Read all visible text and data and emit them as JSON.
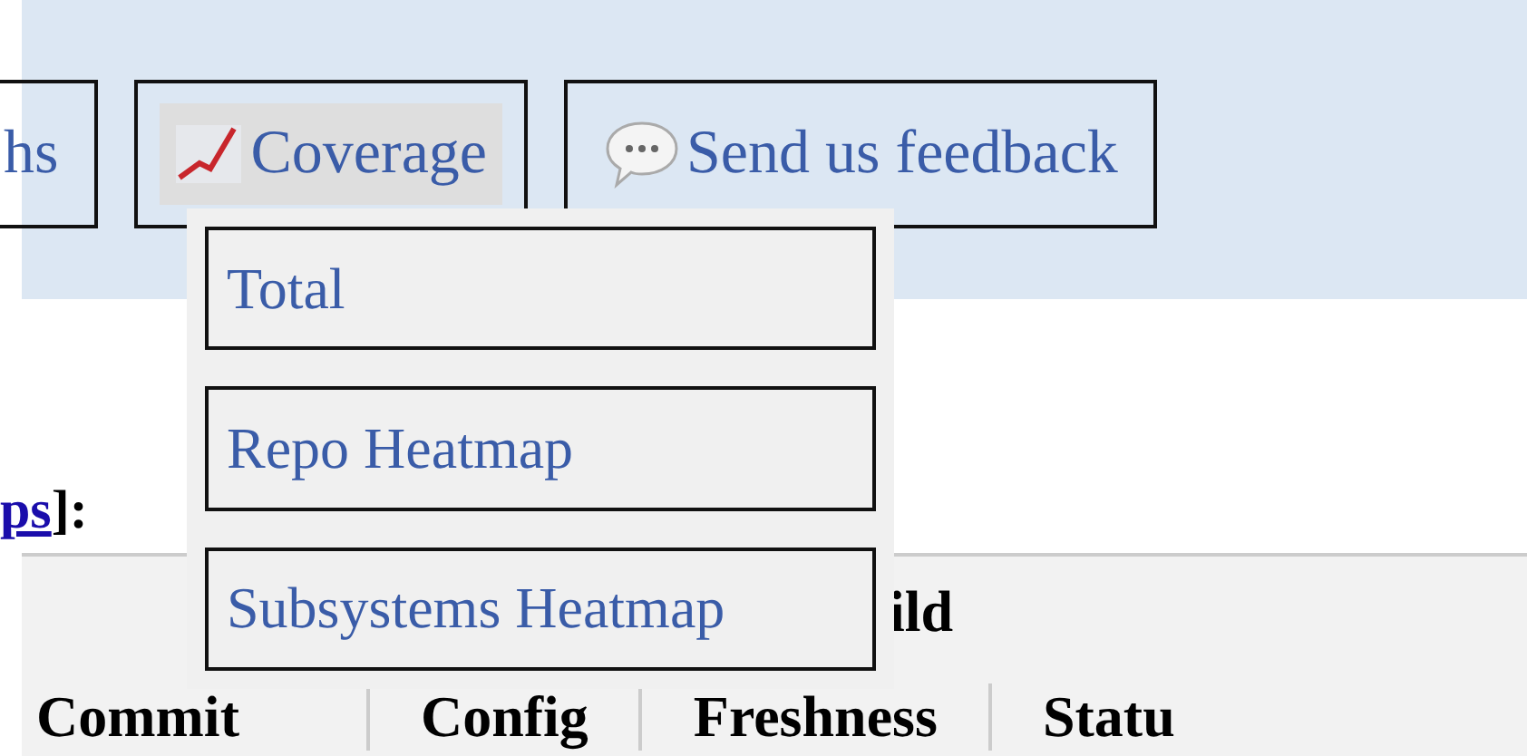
{
  "nav_buttons": [
    {
      "kind": "plain",
      "label": "hs",
      "selected": false
    },
    {
      "kind": "coverage",
      "label": "Coverage",
      "selected": true
    },
    {
      "kind": "feedback",
      "label": "Send us feedback",
      "selected": false
    }
  ],
  "dropdown": {
    "items": [
      "Total",
      "Repo Heatmap",
      "Subsystems Heatmap"
    ]
  },
  "intro": {
    "link": "ps",
    "text": "]:"
  },
  "table": {
    "caption": "ild",
    "columns": [
      "Commit",
      "Config",
      "Freshness",
      "Statu"
    ]
  }
}
